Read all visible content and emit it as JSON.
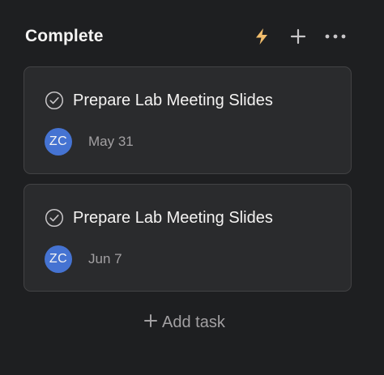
{
  "column": {
    "title": "Complete",
    "actions": [
      {
        "icon": "lightning-bolt-icon",
        "color": "#f1bd6c"
      },
      {
        "icon": "plus-icon"
      },
      {
        "icon": "more-icon"
      }
    ]
  },
  "tasks": [
    {
      "name": "Prepare Lab Meeting Slides",
      "assignee_initials": "ZC",
      "due_date": "May 31"
    },
    {
      "name": "Prepare Lab Meeting Slides",
      "assignee_initials": "ZC",
      "due_date": "Jun 7"
    }
  ],
  "add_task": {
    "label": "Add task"
  },
  "colors": {
    "background": "#1e1f21",
    "card": "#2a2b2d",
    "avatar": "#4573d2",
    "accent_bolt": "#f1bd6c"
  }
}
